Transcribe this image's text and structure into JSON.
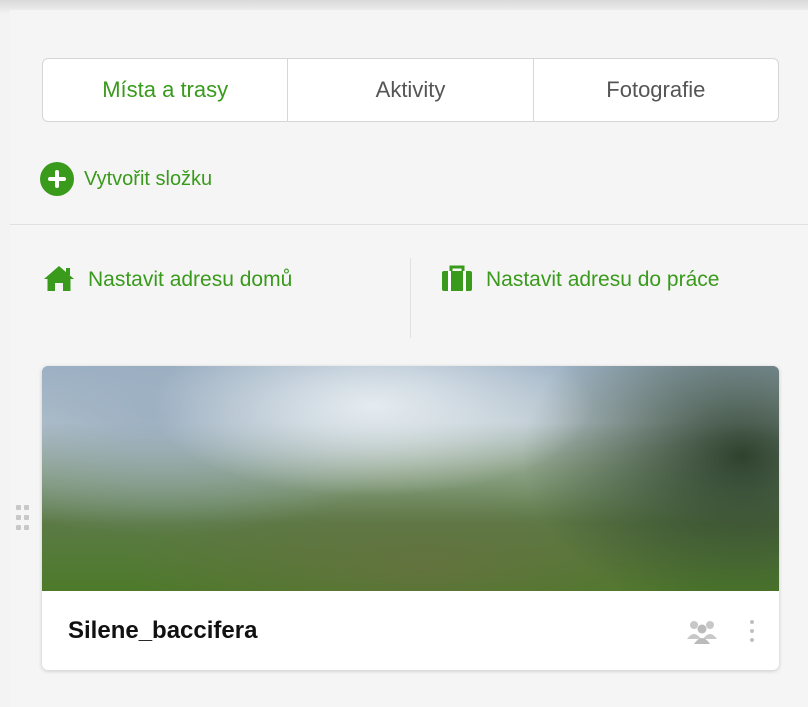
{
  "tabs": [
    {
      "label": "Místa a trasy",
      "active": true
    },
    {
      "label": "Aktivity",
      "active": false
    },
    {
      "label": "Fotografie",
      "active": false
    }
  ],
  "create_folder": {
    "label": "Vytvořit složku",
    "icon": "plus-circle-icon"
  },
  "addresses": {
    "home": {
      "label": "Nastavit adresu domů",
      "icon": "home-icon"
    },
    "work": {
      "label": "Nastavit adresu do práce",
      "icon": "briefcase-icon"
    }
  },
  "card": {
    "title": "Silene_baccifera",
    "icons": [
      "group-icon",
      "more-vertical-icon"
    ]
  },
  "colors": {
    "accent": "#3a9a1c",
    "background": "#f5f5f5",
    "divider": "#e0e0e0"
  }
}
